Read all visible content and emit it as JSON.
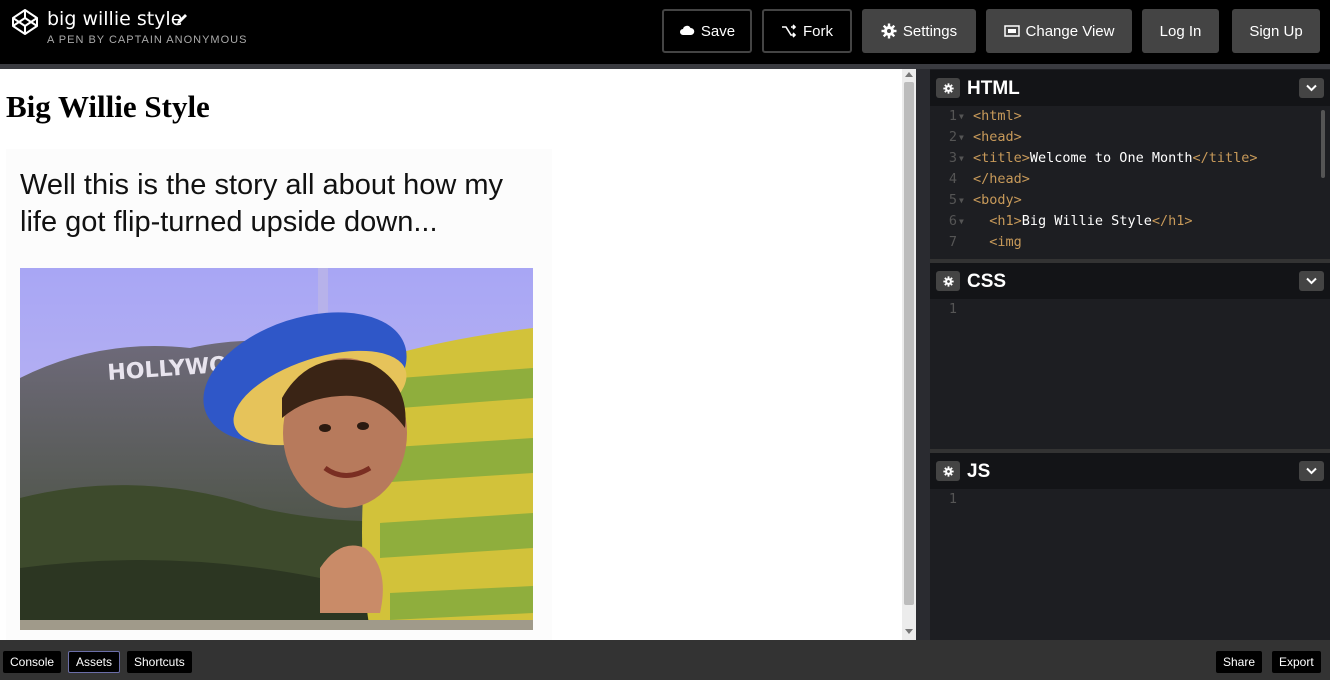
{
  "header": {
    "title": "big willie style",
    "subtitle": "A PEN BY CAPTAIN ANONYMOUS",
    "buttons": {
      "save": "Save",
      "fork": "Fork",
      "settings": "Settings",
      "change_view": "Change View",
      "log_in": "Log In",
      "sign_up": "Sign Up"
    }
  },
  "preview": {
    "heading": "Big Willie Style",
    "caption": "Well this is the story all about how my life got flip-turned upside down...",
    "image_sign_text": "HOLLYWO"
  },
  "editors": {
    "html": {
      "title": "HTML",
      "lines": [
        {
          "n": "1",
          "parts": [
            {
              "t": "<html>",
              "c": "tag"
            }
          ]
        },
        {
          "n": "2",
          "parts": [
            {
              "t": "<head>",
              "c": "tag"
            }
          ]
        },
        {
          "n": "3",
          "parts": [
            {
              "t": "<title>",
              "c": "tag"
            },
            {
              "t": "Welcome to One Month",
              "c": "text"
            },
            {
              "t": "</title>",
              "c": "tag"
            }
          ]
        },
        {
          "n": "4",
          "parts": [
            {
              "t": "</head>",
              "c": "tag"
            }
          ]
        },
        {
          "n": "5",
          "parts": [
            {
              "t": "<body>",
              "c": "tag"
            }
          ]
        },
        {
          "n": "6",
          "parts": [
            {
              "t": "  ",
              "c": "text"
            },
            {
              "t": "<h1>",
              "c": "tag"
            },
            {
              "t": "Big Willie Style",
              "c": "text"
            },
            {
              "t": "</h1>",
              "c": "tag"
            }
          ]
        },
        {
          "n": "7",
          "parts": [
            {
              "t": "  ",
              "c": "text"
            },
            {
              "t": "<img",
              "c": "tag"
            }
          ]
        }
      ]
    },
    "css": {
      "title": "CSS",
      "lines": [
        {
          "n": "1",
          "parts": []
        }
      ]
    },
    "js": {
      "title": "JS",
      "lines": [
        {
          "n": "1",
          "parts": []
        }
      ]
    }
  },
  "footer": {
    "console": "Console",
    "assets": "Assets",
    "shortcuts": "Shortcuts",
    "share": "Share",
    "export": "Export"
  },
  "icons": {
    "logo": "codepen-logo-icon",
    "edit": "pencil-icon",
    "save": "cloud-icon",
    "fork": "fork-icon",
    "settings": "gear-icon",
    "change_view": "layout-icon",
    "editor_settings": "gear-icon",
    "editor_collapse": "chevron-down-icon"
  },
  "colors": {
    "topbar": "#000000",
    "button_solid": "#444444",
    "editor_bg": "#1d1e22",
    "tag": "#c89a5a"
  }
}
